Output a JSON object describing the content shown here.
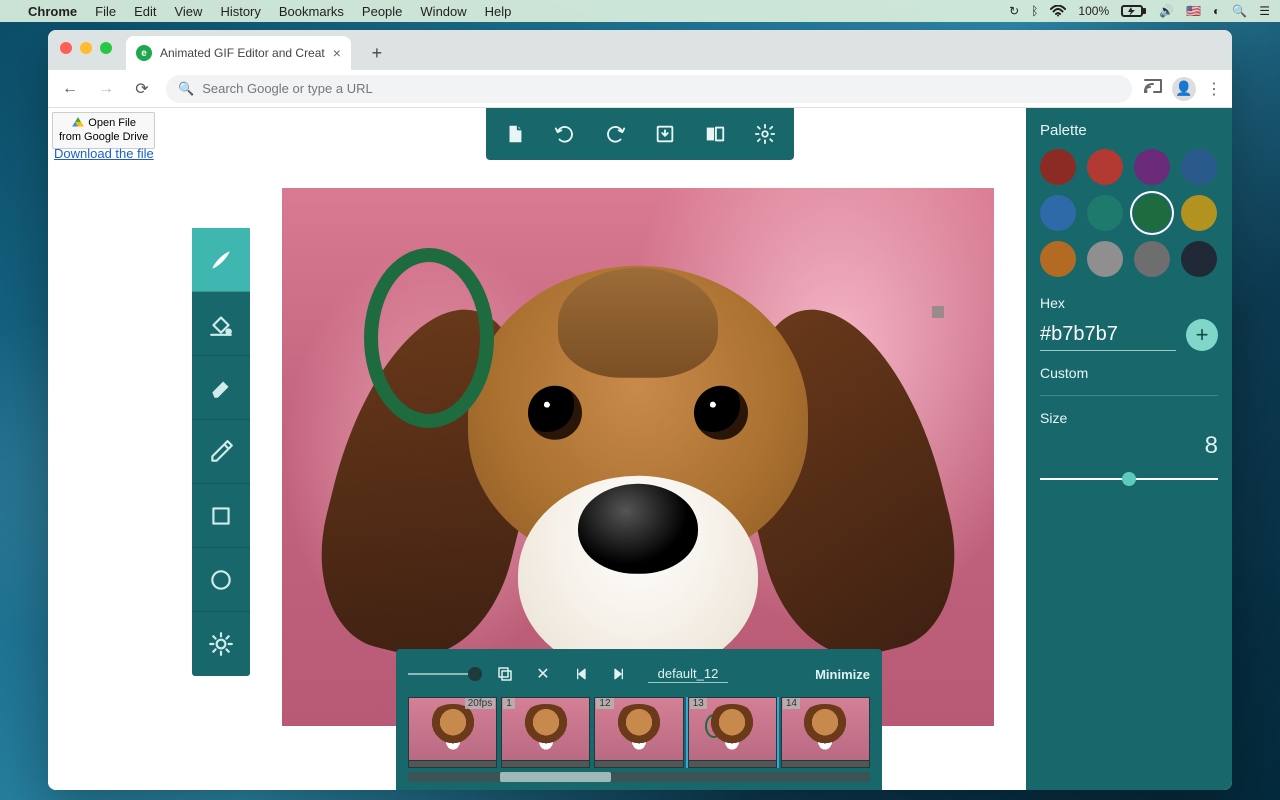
{
  "menubar": {
    "apple": "",
    "app": "Chrome",
    "items": [
      "File",
      "Edit",
      "View",
      "History",
      "Bookmarks",
      "People",
      "Window",
      "Help"
    ],
    "battery": "100%",
    "flag": "🇺🇸"
  },
  "browser": {
    "tab_title": "Animated GIF Editor and Creat",
    "omnibox_placeholder": "Search Google or type a URL"
  },
  "app": {
    "openfile_line1": "Open File",
    "openfile_line2": "from Google Drive",
    "download": "Download the file"
  },
  "sidebar": {
    "palette_label": "Palette",
    "hex_label": "Hex",
    "hex_value": "#b7b7b7",
    "custom_label": "Custom",
    "size_label": "Size",
    "size_value": "8",
    "swatches": [
      {
        "c": "#8c2a24"
      },
      {
        "c": "#b33933"
      },
      {
        "c": "#6b2a7a"
      },
      {
        "c": "#2a5a8c"
      },
      {
        "c": "#2e6aa8"
      },
      {
        "c": "#1f7a6e"
      },
      {
        "c": "#1e6b3f",
        "sel": true
      },
      {
        "c": "#b3931f"
      },
      {
        "c": "#b36a22"
      },
      {
        "c": "#8f8f8f"
      },
      {
        "c": "#6e6e6e"
      },
      {
        "c": "#1f2a36"
      }
    ]
  },
  "frames": {
    "filename": "default_12",
    "minimize": "Minimize",
    "thumbs": [
      {
        "num": "20fps",
        "first": true
      },
      {
        "num": "1"
      },
      {
        "num": "12"
      },
      {
        "num": "13",
        "sel": true,
        "ring": true
      },
      {
        "num": "14"
      }
    ]
  },
  "tools": [
    {
      "id": "brush",
      "active": true
    },
    {
      "id": "fill"
    },
    {
      "id": "eraser"
    },
    {
      "id": "picker"
    },
    {
      "id": "rect"
    },
    {
      "id": "circle"
    },
    {
      "id": "light"
    }
  ]
}
